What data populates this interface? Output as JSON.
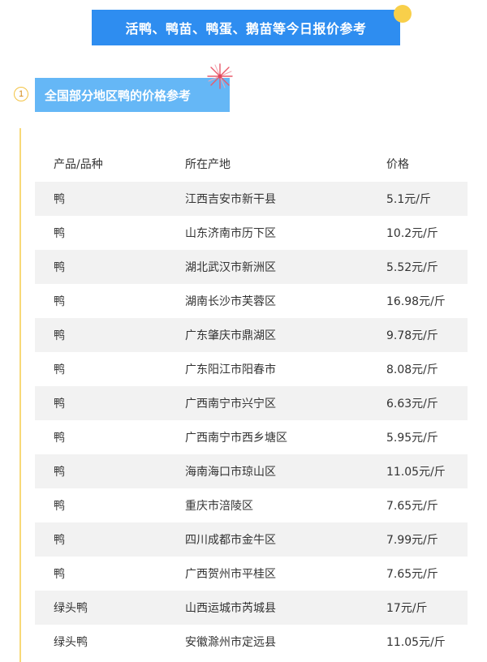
{
  "title": "活鸭、鸭苗、鸭蛋、鹅苗等今日报价参考",
  "section": {
    "number": "1",
    "heading": "全国部分地区鸭的价格参考"
  },
  "table": {
    "headers": [
      "产品/品种",
      "所在产地",
      "价格"
    ],
    "rows": [
      {
        "product": "鸭",
        "origin": "江西吉安市新干县",
        "price": "5.1元/斤"
      },
      {
        "product": "鸭",
        "origin": "山东济南市历下区",
        "price": "10.2元/斤"
      },
      {
        "product": "鸭",
        "origin": "湖北武汉市新洲区",
        "price": "5.52元/斤"
      },
      {
        "product": "鸭",
        "origin": "湖南长沙市芙蓉区",
        "price": "16.98元/斤"
      },
      {
        "product": "鸭",
        "origin": "广东肇庆市鼎湖区",
        "price": "9.78元/斤"
      },
      {
        "product": "鸭",
        "origin": "广东阳江市阳春市",
        "price": "8.08元/斤"
      },
      {
        "product": "鸭",
        "origin": "广西南宁市兴宁区",
        "price": "6.63元/斤"
      },
      {
        "product": "鸭",
        "origin": "广西南宁市西乡塘区",
        "price": "5.95元/斤"
      },
      {
        "product": "鸭",
        "origin": "海南海口市琼山区",
        "price": "11.05元/斤"
      },
      {
        "product": "鸭",
        "origin": "重庆市涪陵区",
        "price": "7.65元/斤"
      },
      {
        "product": "鸭",
        "origin": "四川成都市金牛区",
        "price": "7.99元/斤"
      },
      {
        "product": "鸭",
        "origin": "广西贺州市平桂区",
        "price": "7.65元/斤"
      },
      {
        "product": "绿头鸭",
        "origin": "山西运城市芮城县",
        "price": "17元/斤"
      },
      {
        "product": "绿头鸭",
        "origin": "安徽滁州市定远县",
        "price": "11.05元/斤"
      }
    ]
  },
  "colors": {
    "title_bg": "#2e8df0",
    "heading_bg": "#65b7f6",
    "accent_yellow": "#f8cf4a",
    "row_stripe": "#f2f2f2"
  }
}
